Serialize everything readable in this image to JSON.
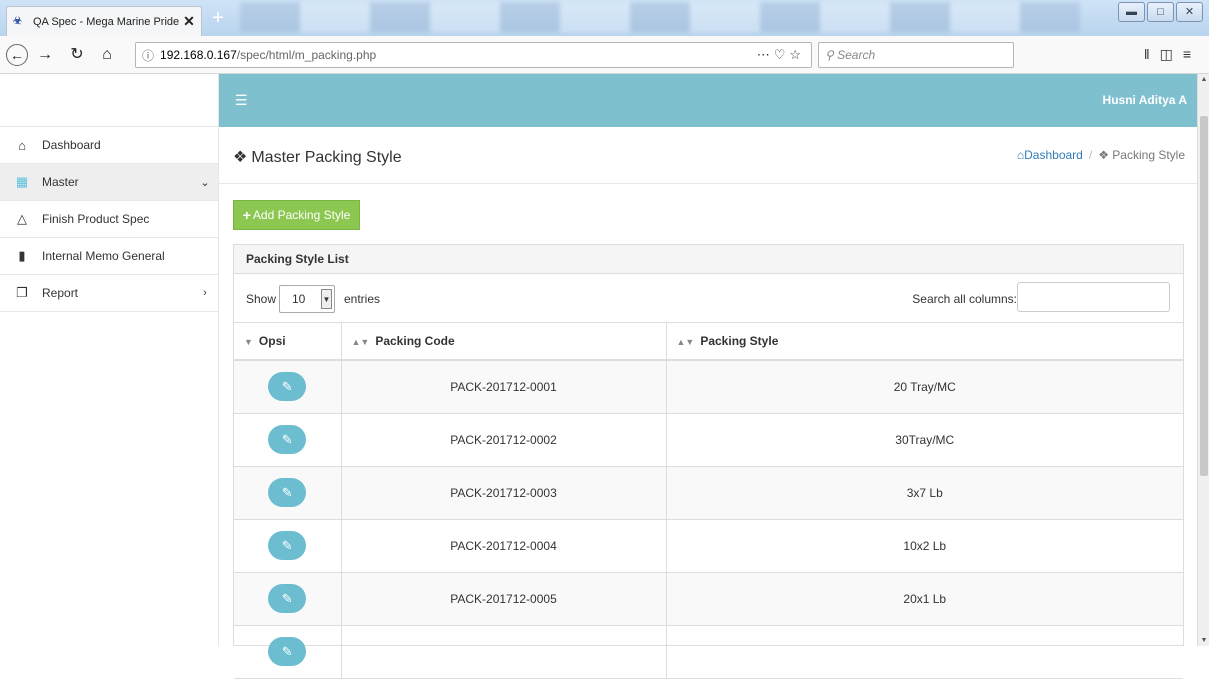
{
  "browser": {
    "tab_title": "QA Spec - Mega Marine Pride",
    "url_host": "192.168.0.167",
    "url_path": "/spec/html/m_packing.php",
    "search_placeholder": "Search"
  },
  "header": {
    "user_name": "Husni Aditya A"
  },
  "sidebar": {
    "items": [
      {
        "label": "Dashboard",
        "icon": "home-icon"
      },
      {
        "label": "Master",
        "icon": "grid-icon"
      },
      {
        "label": "Finish Product Spec",
        "icon": "flask-icon"
      },
      {
        "label": "Internal Memo General",
        "icon": "file-icon"
      },
      {
        "label": "Report",
        "icon": "copy-icon"
      }
    ]
  },
  "page": {
    "title": "Master Packing Style",
    "breadcrumb_home": "Dashboard",
    "breadcrumb_current": "Packing Style",
    "add_button": "Add Packing Style"
  },
  "panel": {
    "title": "Packing Style List",
    "show_label": "Show",
    "entries_value": "10",
    "entries_label": "entries",
    "search_label": "Search all columns:"
  },
  "table": {
    "columns": [
      "Opsi",
      "Packing Code",
      "Packing Style"
    ],
    "rows": [
      {
        "code": "PACK-201712-0001",
        "style": "20 Tray/MC"
      },
      {
        "code": "PACK-201712-0002",
        "style": "30Tray/MC"
      },
      {
        "code": "PACK-201712-0003",
        "style": "3x7 Lb"
      },
      {
        "code": "PACK-201712-0004",
        "style": "10x2 Lb"
      },
      {
        "code": "PACK-201712-0005",
        "style": "20x1 Lb"
      }
    ]
  },
  "colors": {
    "topbar": "#7fc0cf",
    "add_button": "#8cc751",
    "edit_button": "#6cbdd0"
  }
}
